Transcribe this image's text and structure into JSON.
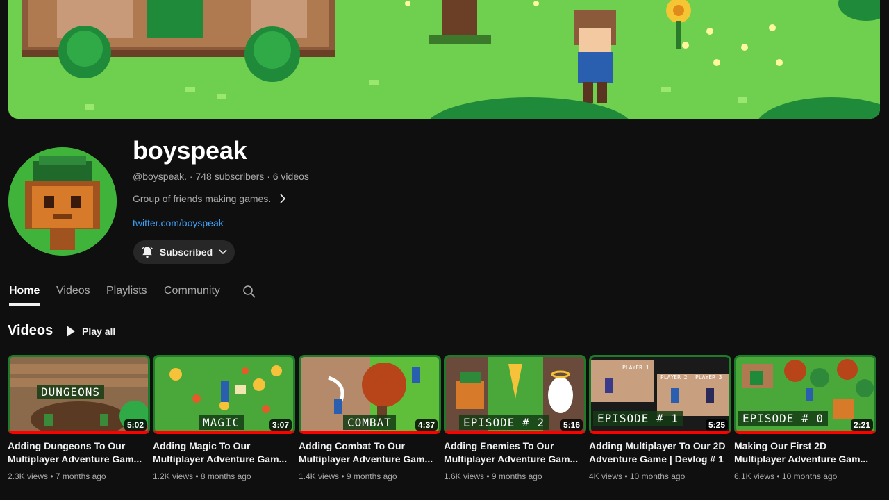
{
  "channel": {
    "name": "boyspeak",
    "meta": "@boyspeak. · 748 subscribers · 6 videos",
    "description": "Group of friends making games.",
    "link": "twitter.com/boyspeak_",
    "subscribe_label": "Subscribed"
  },
  "tabs": [
    {
      "label": "Home",
      "active": true
    },
    {
      "label": "Videos",
      "active": false
    },
    {
      "label": "Playlists",
      "active": false
    },
    {
      "label": "Community",
      "active": false
    }
  ],
  "section": {
    "title": "Videos",
    "play_all": "Play all"
  },
  "videos": [
    {
      "caption": "DUNGEONS",
      "duration": "5:02",
      "title": "Adding Dungeons To Our Multiplayer Adventure Gam...",
      "meta": "2.3K views • 7 months ago"
    },
    {
      "caption": "MAGIC",
      "duration": "3:07",
      "title": "Adding Magic To Our Multiplayer Adventure Gam...",
      "meta": "1.2K views • 8 months ago"
    },
    {
      "caption": "COMBAT",
      "duration": "4:37",
      "title": "Adding Combat To Our Multiplayer Adventure Gam...",
      "meta": "1.4K views • 9 months ago"
    },
    {
      "caption": "EPISODE # 2",
      "duration": "5:16",
      "title": "Adding Enemies To Our Multiplayer Adventure Gam...",
      "meta": "1.6K views • 9 months ago"
    },
    {
      "caption": "EPISODE # 1",
      "duration": "5:25",
      "title": "Adding Multiplayer To Our 2D Adventure Game | Devlog # 1",
      "meta": "4K views • 10 months ago"
    },
    {
      "caption": "EPISODE # 0",
      "duration": "2:21",
      "title": "Making Our First 2D Multiplayer Adventure Gam...",
      "meta": "6.1K views • 10 months ago"
    }
  ],
  "thumb_labels": {
    "player1": "PLAYER 1",
    "player2": "PLAYER 2",
    "player3": "PLAYER 3"
  },
  "colors": {
    "background": "#0f0f0f",
    "link": "#3ea6ff",
    "progress": "#ff0000",
    "banner_grass": "#6fcf4f"
  },
  "icons": [
    "bell-icon",
    "chevron-down-icon",
    "chevron-right-icon",
    "search-icon",
    "play-icon"
  ]
}
